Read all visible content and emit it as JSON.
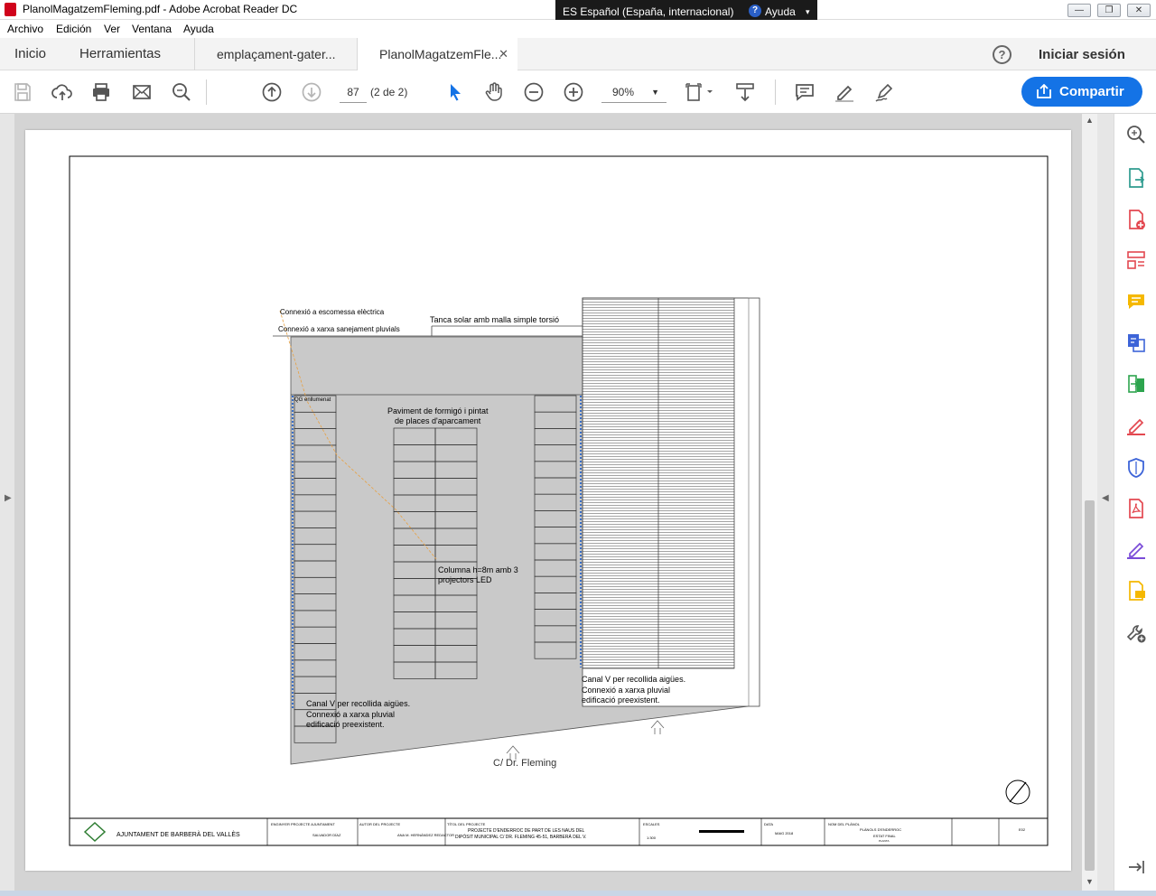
{
  "window": {
    "title": "PlanolMagatzemFleming.pdf - Adobe Acrobat Reader DC",
    "language_bar": "ES Español (España, internacional)",
    "language_help": "Ayuda"
  },
  "menu": {
    "items": [
      "Archivo",
      "Edición",
      "Ver",
      "Ventana",
      "Ayuda"
    ]
  },
  "tabs": {
    "home": "Inicio",
    "tools": "Herramientas",
    "docs": [
      {
        "label": "emplaçament-gater..."
      },
      {
        "label": "PlanolMagatzemFle..."
      }
    ],
    "signin": "Iniciar sesión"
  },
  "toolbar": {
    "page_number": "87",
    "page_of": "(2 de 2)",
    "zoom": "90%",
    "share_label": "Compartir"
  },
  "plan": {
    "labels": {
      "connexio_electrica": "Connexió a escomessa elèctrica",
      "connexio_pluvials": "Connexió a xarxa sanejament pluvials",
      "tanca": "Tanca solar amb malla simple torsió",
      "enllumenat": "QG enllumenat",
      "paviment_1": "Paviment de formigó i pintat",
      "paviment_2": "de places d'aparcament",
      "columna_1": "Columna h=8m amb 3",
      "columna_2": "projectors LED",
      "canal_left_1": "Canal V per recollida aigües.",
      "canal_left_2": "Connexió a xarxa pluvial",
      "canal_left_3": "edificació preexistent.",
      "canal_right_1": "Canal V per recollida aigües.",
      "canal_right_2": "Connexió a xarxa pluvial",
      "canal_right_3": "edificació preexistent.",
      "street": "C/ Dr. Fleming"
    },
    "title_block": {
      "ajuntament": "AJUNTAMENT DE BARBERÀ DEL VALLÈS",
      "enginyer_label": "ENGINYER PROJECTE AJUNTAMENT",
      "enginyer": "SALVADOR DÍAZ",
      "autor_label": "AUTOR DEL PROJECTE",
      "autor": "ANA M. HERNÁNDEZ REDACTOR",
      "titol_label": "TÍTOL DEL PROJECTE",
      "titol_1": "PROJECTE D'ENDERROC DE PART DE LES NAUS DEL",
      "titol_2": "DIPÒSIT MUNICIPAL C/ DR. FLEMING 45-51, BARBERÀ DEL V.",
      "escala_label": "ESCALES",
      "escala": "1:300",
      "data_label": "DATA",
      "data": "MAIG 2018",
      "plano_label": "NOM DEL PLÀNOL",
      "plano_1": "PLÀNOLS D'ENDERROC",
      "plano_2": "ESTAT FINAL",
      "plano_3": "PLANTA",
      "num": "E02"
    }
  }
}
